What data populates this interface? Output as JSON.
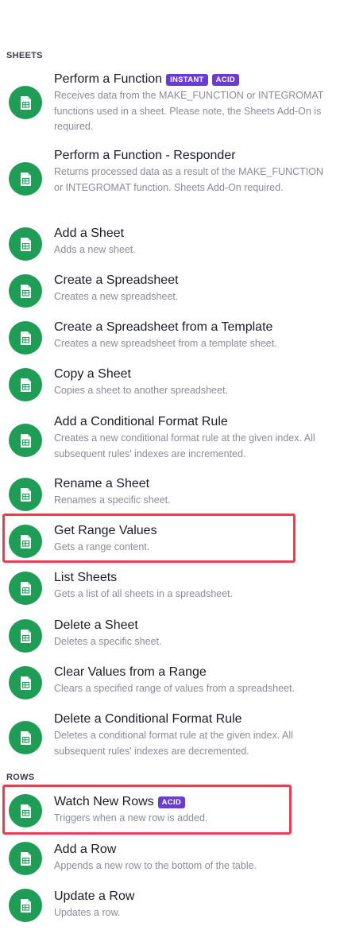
{
  "colors": {
    "icon_bg": "#1f9d57",
    "badge_bg": "#6a3cd4",
    "highlight": "#f03a4f"
  },
  "icon": "google-sheets-icon",
  "sections": {
    "sheets": "SHEETS",
    "rows": "ROWS"
  },
  "items": [
    {
      "title": "Perform a Function",
      "badges": [
        "INSTANT",
        "ACID"
      ],
      "description": "Receives data from the MAKE_FUNCTION or INTEGROMAT functions used in a sheet. Please note, the Sheets Add-On is required."
    },
    {
      "title": "Perform a Function - Responder",
      "badges": [],
      "description": "Returns processed data as a result of the MAKE_FUNCTION or INTEGROMAT function. Sheets Add-On required."
    },
    {
      "title": "Add a Sheet",
      "badges": [],
      "description": "Adds a new sheet."
    },
    {
      "title": "Create a Spreadsheet",
      "badges": [],
      "description": "Creates a new spreadsheet."
    },
    {
      "title": "Create a Spreadsheet from a Template",
      "badges": [],
      "description": "Creates a new spreadsheet from a template sheet."
    },
    {
      "title": "Copy a Sheet",
      "badges": [],
      "description": "Copies a sheet to another spreadsheet."
    },
    {
      "title": "Add a Conditional Format Rule",
      "badges": [],
      "description": "Creates a new conditional format rule at the given index. All subsequent rules' indexes are incremented."
    },
    {
      "title": "Rename a Sheet",
      "badges": [],
      "description": "Renames a specific sheet."
    },
    {
      "title": "Get Range Values",
      "badges": [],
      "description": "Gets a range content.",
      "highlighted": true
    },
    {
      "title": "List Sheets",
      "badges": [],
      "description": "Gets a list of all sheets in a spreadsheet."
    },
    {
      "title": "Delete a Sheet",
      "badges": [],
      "description": "Deletes a specific sheet."
    },
    {
      "title": "Clear Values from a Range",
      "badges": [],
      "description": "Clears a specified range of values from a spreadsheet."
    },
    {
      "title": "Delete a Conditional Format Rule",
      "badges": [],
      "description": "Deletes a conditional format rule at the given index. All subsequent rules' indexes are decremented."
    },
    {
      "title": "Watch New Rows",
      "badges": [
        "ACID"
      ],
      "description": "Triggers when a new row is added.",
      "highlighted": true
    },
    {
      "title": "Add a Row",
      "badges": [],
      "description": "Appends a new row to the bottom of the table."
    },
    {
      "title": "Update a Row",
      "badges": [],
      "description": "Updates a row."
    }
  ]
}
